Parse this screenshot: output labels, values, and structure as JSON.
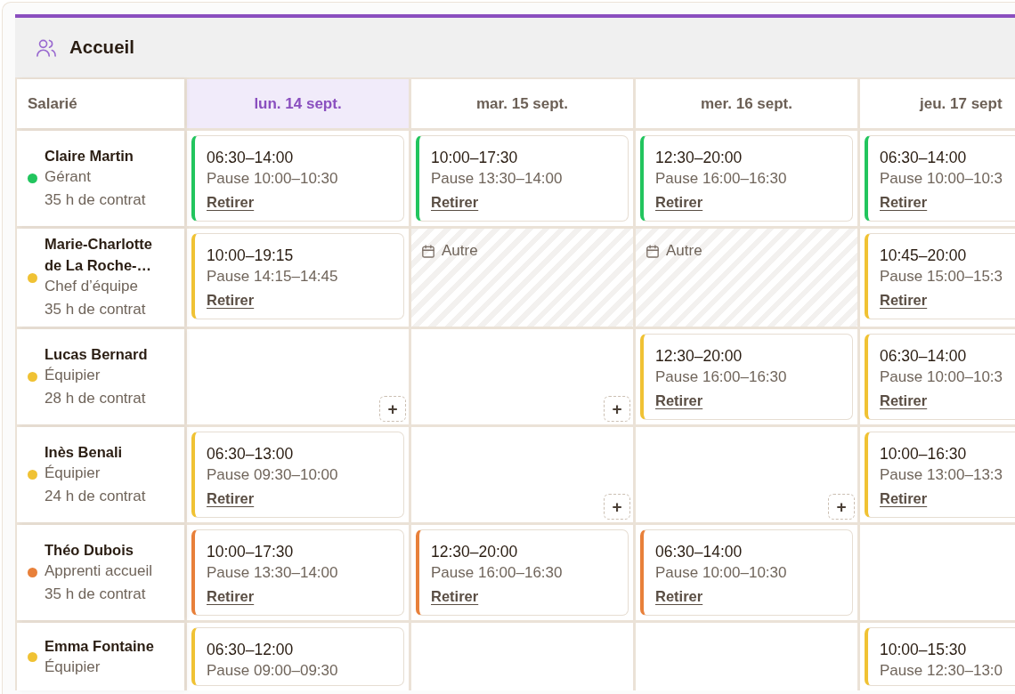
{
  "panel": {
    "title": "Accueil"
  },
  "table": {
    "corner_label": "Salarié",
    "days": [
      {
        "label": "lun. 14 sept.",
        "selected": true
      },
      {
        "label": "mar. 15 sept.",
        "selected": false
      },
      {
        "label": "mer. 16 sept.",
        "selected": false
      },
      {
        "label": "jeu. 17 sept",
        "selected": false
      }
    ],
    "rows": [
      {
        "employee": {
          "name": "Claire Martin",
          "role": "Gérant",
          "contract": "35 h de contrat",
          "color": "#22c55e"
        },
        "cells": [
          {
            "kind": "shift",
            "time": "06:30–14:00",
            "pause": "Pause 10:00–10:30",
            "action": "Retirer"
          },
          {
            "kind": "shift",
            "time": "10:00–17:30",
            "pause": "Pause 13:30–14:00",
            "action": "Retirer"
          },
          {
            "kind": "shift",
            "time": "12:30–20:00",
            "pause": "Pause 16:00–16:30",
            "action": "Retirer"
          },
          {
            "kind": "shift",
            "time": "06:30–14:00",
            "pause": "Pause 10:00–10:3",
            "action": "Retirer"
          }
        ]
      },
      {
        "employee": {
          "name": "Marie-Charlotte de La Roche-…",
          "role": "Chef d’équipe",
          "contract": "35 h de contrat",
          "color": "#f0c234"
        },
        "cells": [
          {
            "kind": "shift",
            "time": "10:00–19:15",
            "pause": "Pause 14:15–14:45",
            "action": "Retirer"
          },
          {
            "kind": "absence",
            "label": "Autre"
          },
          {
            "kind": "absence",
            "label": "Autre"
          },
          {
            "kind": "shift",
            "time": "10:45–20:00",
            "pause": "Pause 15:00–15:3",
            "action": "Retirer"
          }
        ]
      },
      {
        "employee": {
          "name": "Lucas Bernard",
          "role": "Équipier",
          "contract": "28 h de contrat",
          "color": "#f0c234"
        },
        "cells": [
          {
            "kind": "empty",
            "add": "+"
          },
          {
            "kind": "empty",
            "add": "+"
          },
          {
            "kind": "shift",
            "time": "12:30–20:00",
            "pause": "Pause 16:00–16:30",
            "action": "Retirer"
          },
          {
            "kind": "shift",
            "time": "06:30–14:00",
            "pause": "Pause 10:00–10:3",
            "action": "Retirer"
          }
        ]
      },
      {
        "employee": {
          "name": "Inès Benali",
          "role": "Équipier",
          "contract": "24 h de contrat",
          "color": "#f0c234"
        },
        "cells": [
          {
            "kind": "shift",
            "time": "06:30–13:00",
            "pause": "Pause 09:30–10:00",
            "action": "Retirer"
          },
          {
            "kind": "empty",
            "add": "+"
          },
          {
            "kind": "empty",
            "add": "+"
          },
          {
            "kind": "shift",
            "time": "10:00–16:30",
            "pause": "Pause 13:00–13:3",
            "action": "Retirer"
          }
        ]
      },
      {
        "employee": {
          "name": "Théo Dubois",
          "role": "Apprenti accueil",
          "contract": "35 h de contrat",
          "color": "#e8803a"
        },
        "cells": [
          {
            "kind": "shift",
            "time": "10:00–17:30",
            "pause": "Pause 13:30–14:00",
            "action": "Retirer"
          },
          {
            "kind": "shift",
            "time": "12:30–20:00",
            "pause": "Pause 16:00–16:30",
            "action": "Retirer"
          },
          {
            "kind": "shift",
            "time": "06:30–14:00",
            "pause": "Pause 10:00–10:30",
            "action": "Retirer"
          },
          {
            "kind": "empty"
          }
        ]
      },
      {
        "employee": {
          "name": "Emma Fontaine",
          "role": "Équipier",
          "color": "#f0c234"
        },
        "cells": [
          {
            "kind": "shift",
            "time": "06:30–12:00",
            "pause": "Pause 09:00–09:30"
          },
          {
            "kind": "empty"
          },
          {
            "kind": "empty"
          },
          {
            "kind": "shift",
            "time": "10:00–15:30",
            "pause": "Pause 12:30–13:0"
          }
        ]
      }
    ]
  }
}
